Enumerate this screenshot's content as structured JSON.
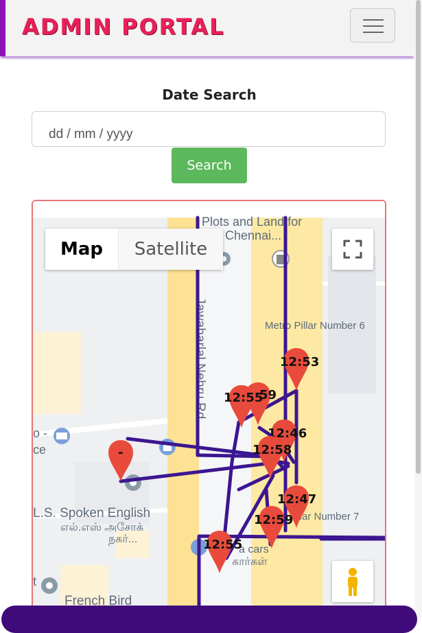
{
  "header": {
    "brand": "ADMIN PORTAL",
    "menu_icon": "hamburger-icon",
    "brand_color": "#e8205a",
    "accent_color": "#8e12b6"
  },
  "search": {
    "label": "Date Search",
    "placeholder": "dd / mm / yyyy",
    "button_label": "Search",
    "button_color": "#5cb85c"
  },
  "map": {
    "type_control": {
      "map": "Map",
      "satellite": "Satellite"
    },
    "fullscreen_icon": "fullscreen-icon",
    "pegman_icon": "pegman-icon",
    "route_color": "#3c1690",
    "marker_color": "#e84b3c",
    "labels": {
      "plots_line1": "Plots and Land for",
      "plots_line2": "e in Chennai...",
      "road": "Jawaharlal Nehru Rd",
      "metro6": "Metro Pillar Number 6",
      "metro7": "illar Number 7",
      "spoken_en": "L.S. Spoken English",
      "spoken_ta1": "எல்.எஸ் அசோக்",
      "spoken_ta2": "நகர்...",
      "french_bird": "French Bird",
      "left_top": "o -",
      "left_mid": "ce",
      "left_bot": "t",
      "cars_en": "a cars",
      "cars_ta": "கார்கள்"
    },
    "markers": [
      "12:53",
      "12:55",
      "59",
      "12:46",
      "12:58",
      "-",
      "12:47",
      "12:59",
      "12:55"
    ]
  }
}
